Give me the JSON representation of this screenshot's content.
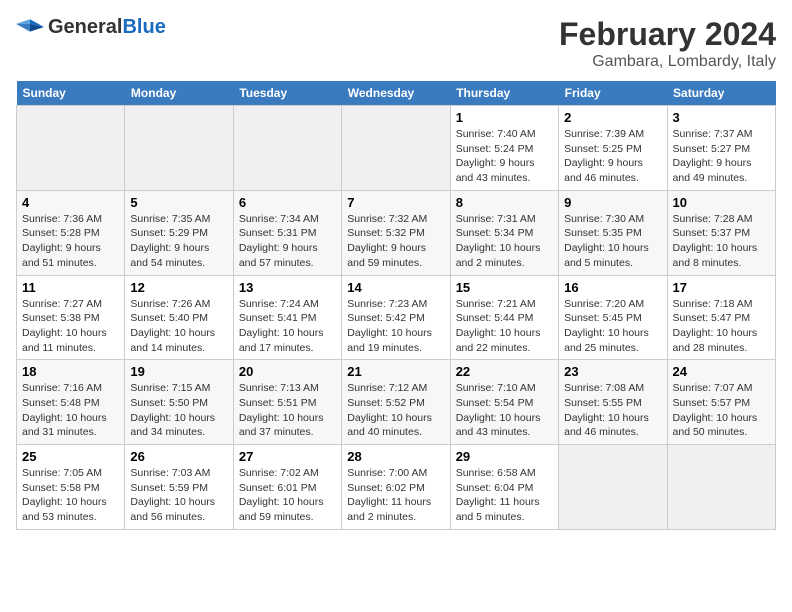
{
  "header": {
    "logo_line1": "General",
    "logo_line2": "Blue",
    "title": "February 2024",
    "subtitle": "Gambara, Lombardy, Italy"
  },
  "calendar": {
    "days_of_week": [
      "Sunday",
      "Monday",
      "Tuesday",
      "Wednesday",
      "Thursday",
      "Friday",
      "Saturday"
    ],
    "weeks": [
      [
        {
          "day": "",
          "info": ""
        },
        {
          "day": "",
          "info": ""
        },
        {
          "day": "",
          "info": ""
        },
        {
          "day": "",
          "info": ""
        },
        {
          "day": "1",
          "info": "Sunrise: 7:40 AM\nSunset: 5:24 PM\nDaylight: 9 hours\nand 43 minutes."
        },
        {
          "day": "2",
          "info": "Sunrise: 7:39 AM\nSunset: 5:25 PM\nDaylight: 9 hours\nand 46 minutes."
        },
        {
          "day": "3",
          "info": "Sunrise: 7:37 AM\nSunset: 5:27 PM\nDaylight: 9 hours\nand 49 minutes."
        }
      ],
      [
        {
          "day": "4",
          "info": "Sunrise: 7:36 AM\nSunset: 5:28 PM\nDaylight: 9 hours\nand 51 minutes."
        },
        {
          "day": "5",
          "info": "Sunrise: 7:35 AM\nSunset: 5:29 PM\nDaylight: 9 hours\nand 54 minutes."
        },
        {
          "day": "6",
          "info": "Sunrise: 7:34 AM\nSunset: 5:31 PM\nDaylight: 9 hours\nand 57 minutes."
        },
        {
          "day": "7",
          "info": "Sunrise: 7:32 AM\nSunset: 5:32 PM\nDaylight: 9 hours\nand 59 minutes."
        },
        {
          "day": "8",
          "info": "Sunrise: 7:31 AM\nSunset: 5:34 PM\nDaylight: 10 hours\nand 2 minutes."
        },
        {
          "day": "9",
          "info": "Sunrise: 7:30 AM\nSunset: 5:35 PM\nDaylight: 10 hours\nand 5 minutes."
        },
        {
          "day": "10",
          "info": "Sunrise: 7:28 AM\nSunset: 5:37 PM\nDaylight: 10 hours\nand 8 minutes."
        }
      ],
      [
        {
          "day": "11",
          "info": "Sunrise: 7:27 AM\nSunset: 5:38 PM\nDaylight: 10 hours\nand 11 minutes."
        },
        {
          "day": "12",
          "info": "Sunrise: 7:26 AM\nSunset: 5:40 PM\nDaylight: 10 hours\nand 14 minutes."
        },
        {
          "day": "13",
          "info": "Sunrise: 7:24 AM\nSunset: 5:41 PM\nDaylight: 10 hours\nand 17 minutes."
        },
        {
          "day": "14",
          "info": "Sunrise: 7:23 AM\nSunset: 5:42 PM\nDaylight: 10 hours\nand 19 minutes."
        },
        {
          "day": "15",
          "info": "Sunrise: 7:21 AM\nSunset: 5:44 PM\nDaylight: 10 hours\nand 22 minutes."
        },
        {
          "day": "16",
          "info": "Sunrise: 7:20 AM\nSunset: 5:45 PM\nDaylight: 10 hours\nand 25 minutes."
        },
        {
          "day": "17",
          "info": "Sunrise: 7:18 AM\nSunset: 5:47 PM\nDaylight: 10 hours\nand 28 minutes."
        }
      ],
      [
        {
          "day": "18",
          "info": "Sunrise: 7:16 AM\nSunset: 5:48 PM\nDaylight: 10 hours\nand 31 minutes."
        },
        {
          "day": "19",
          "info": "Sunrise: 7:15 AM\nSunset: 5:50 PM\nDaylight: 10 hours\nand 34 minutes."
        },
        {
          "day": "20",
          "info": "Sunrise: 7:13 AM\nSunset: 5:51 PM\nDaylight: 10 hours\nand 37 minutes."
        },
        {
          "day": "21",
          "info": "Sunrise: 7:12 AM\nSunset: 5:52 PM\nDaylight: 10 hours\nand 40 minutes."
        },
        {
          "day": "22",
          "info": "Sunrise: 7:10 AM\nSunset: 5:54 PM\nDaylight: 10 hours\nand 43 minutes."
        },
        {
          "day": "23",
          "info": "Sunrise: 7:08 AM\nSunset: 5:55 PM\nDaylight: 10 hours\nand 46 minutes."
        },
        {
          "day": "24",
          "info": "Sunrise: 7:07 AM\nSunset: 5:57 PM\nDaylight: 10 hours\nand 50 minutes."
        }
      ],
      [
        {
          "day": "25",
          "info": "Sunrise: 7:05 AM\nSunset: 5:58 PM\nDaylight: 10 hours\nand 53 minutes."
        },
        {
          "day": "26",
          "info": "Sunrise: 7:03 AM\nSunset: 5:59 PM\nDaylight: 10 hours\nand 56 minutes."
        },
        {
          "day": "27",
          "info": "Sunrise: 7:02 AM\nSunset: 6:01 PM\nDaylight: 10 hours\nand 59 minutes."
        },
        {
          "day": "28",
          "info": "Sunrise: 7:00 AM\nSunset: 6:02 PM\nDaylight: 11 hours\nand 2 minutes."
        },
        {
          "day": "29",
          "info": "Sunrise: 6:58 AM\nSunset: 6:04 PM\nDaylight: 11 hours\nand 5 minutes."
        },
        {
          "day": "",
          "info": ""
        },
        {
          "day": "",
          "info": ""
        }
      ]
    ]
  }
}
